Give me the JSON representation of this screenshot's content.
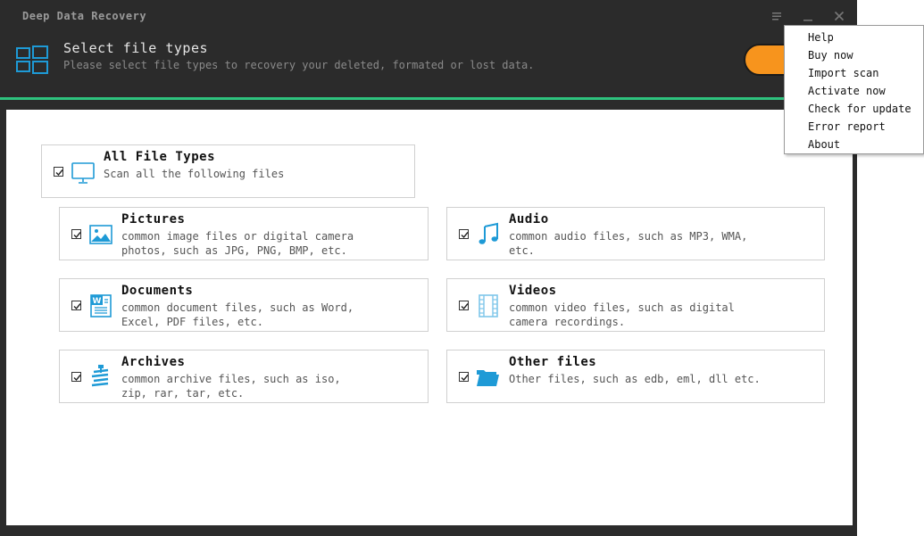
{
  "app": {
    "title": "Deep Data Recovery"
  },
  "header": {
    "title": "Select file types",
    "subtitle": "Please select file types to recovery your deleted, formated or lost data."
  },
  "menu": {
    "items": [
      "Help",
      "Buy now",
      "Import scan",
      "Activate now",
      "Check for update",
      "Error report",
      "About"
    ]
  },
  "all_types": {
    "title": "All File Types",
    "desc": "Scan all the following files",
    "checked": true
  },
  "file_types": [
    {
      "title": "Pictures",
      "desc": "common image files or digital camera\nphotos, such as JPG, PNG, BMP, etc.",
      "icon": "picture-icon",
      "checked": true
    },
    {
      "title": "Audio",
      "desc": "common audio files, such as MP3, WMA,\netc.",
      "icon": "music-note-icon",
      "checked": true
    },
    {
      "title": "Documents",
      "desc": "common document files, such as Word,\nExcel, PDF files, etc.",
      "icon": "word-document-icon",
      "checked": true
    },
    {
      "title": "Videos",
      "desc": "common video files, such as digital\ncamera recordings.",
      "icon": "film-strip-icon",
      "checked": true
    },
    {
      "title": "Archives",
      "desc": "common archive files, such as iso,\nzip, rar, tar, etc.",
      "icon": "archive-icon",
      "checked": true
    },
    {
      "title": "Other files",
      "desc": "Other files, such as edb, eml, dll etc.",
      "icon": "folder-icon",
      "checked": true
    }
  ],
  "colors": {
    "accent": "#2ec27e",
    "button": "#f7941d",
    "icon": "#1e9ad6",
    "header_bg": "#2b2b2b"
  }
}
